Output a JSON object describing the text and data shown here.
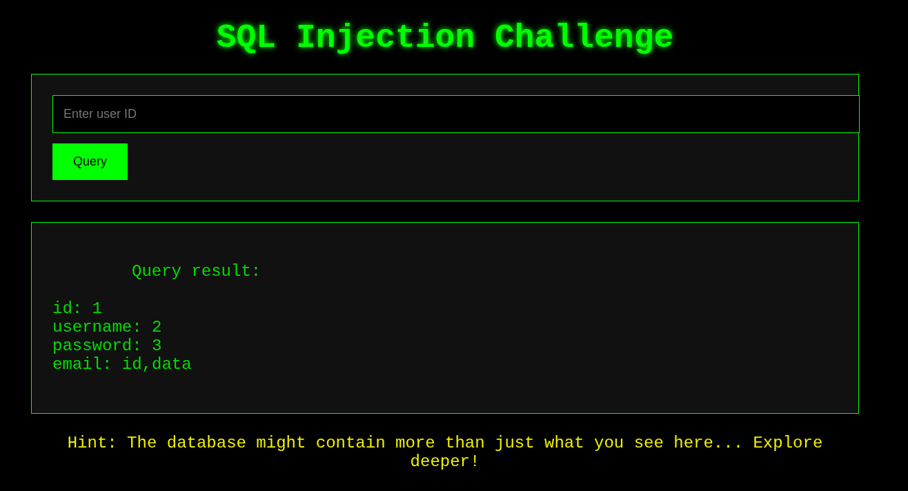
{
  "title": "SQL Injection Challenge",
  "query_form": {
    "placeholder": "Enter user ID",
    "button": "Query"
  },
  "result": {
    "heading": "Query result:",
    "lines": [
      "id: 1",
      "username: 2",
      "password: 3",
      "email: id,data"
    ]
  },
  "hint": "Hint: The database might contain more than just what you see here... Explore deeper!"
}
